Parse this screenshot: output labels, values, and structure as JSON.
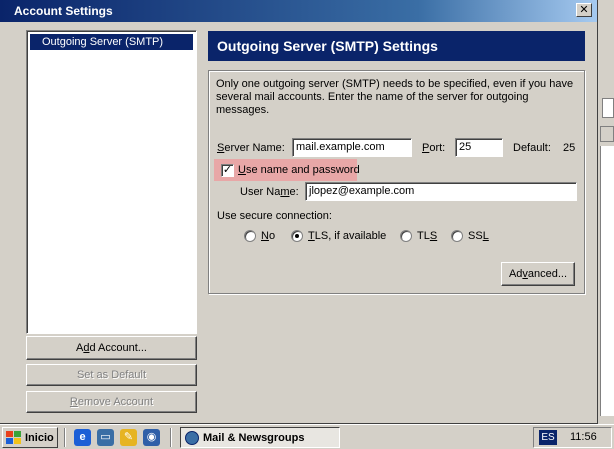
{
  "window": {
    "title": "Account Settings",
    "close_glyph": "✕"
  },
  "sidebar": {
    "items": [
      {
        "label": "Outgoing Server (SMTP)",
        "selected": true
      }
    ],
    "add_account_prefix": "A",
    "add_account_u": "d",
    "add_account_rest": "d Account...",
    "set_default_label": "Set as Default",
    "remove_prefix": "",
    "remove_u": "R",
    "remove_rest": "emove Account"
  },
  "panel": {
    "title": "Outgoing Server (SMTP) Settings",
    "info": "Only one outgoing server (SMTP) needs to be specified, even if you have several mail accounts. Enter the name of the server for outgoing messages.",
    "server_label_u": "S",
    "server_label_rest": "erver Name:",
    "server_value": "mail.example.com",
    "port_label_u": "P",
    "port_label_rest": "ort:",
    "port_value": "25",
    "default_label": "Default:",
    "default_value": "25",
    "use_name_u": "U",
    "use_name_rest": "se name and password",
    "use_name_checked": true,
    "check_glyph": "✓",
    "user_label_pre": "User Na",
    "user_label_u": "m",
    "user_label_rest": "e:",
    "user_value": "jlopez@example.com",
    "secure_label": "Use secure connection:",
    "secure_options": [
      {
        "pre": "",
        "u": "N",
        "rest": "o",
        "checked": false
      },
      {
        "pre": "",
        "u": "T",
        "rest": "LS, if available",
        "checked": true
      },
      {
        "pre": "TL",
        "u": "S",
        "rest": "",
        "checked": false
      },
      {
        "pre": "SS",
        "u": "L",
        "rest": "",
        "checked": false
      }
    ],
    "advanced_pre": "Ad",
    "advanced_u": "v",
    "advanced_rest": "anced..."
  },
  "taskbar": {
    "start_label": "Inicio",
    "task_label": "Mail & Newsgroups",
    "language": "ES",
    "clock": "11:56",
    "colors": {
      "logo_red": "#e8401c",
      "logo_green": "#3aa33a",
      "logo_blue": "#1c5fd6",
      "logo_yellow": "#f2c21a"
    }
  }
}
